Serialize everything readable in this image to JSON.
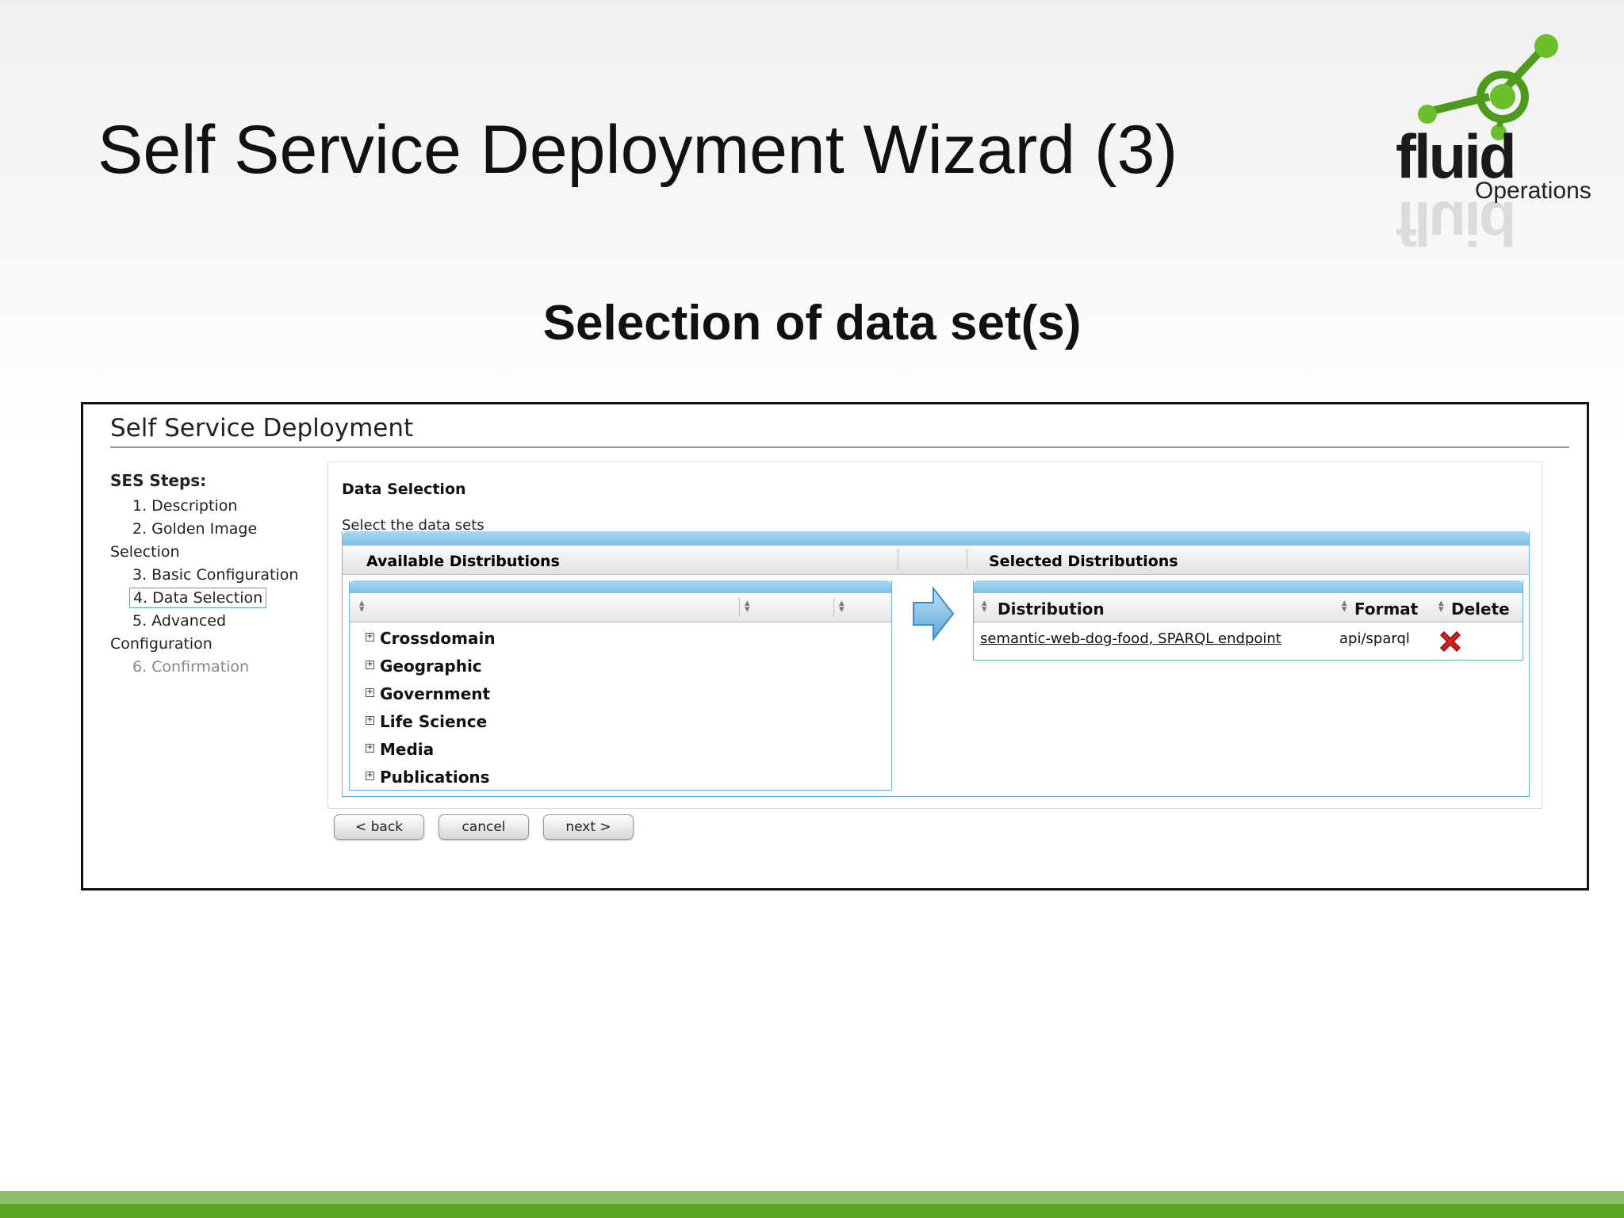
{
  "slide": {
    "title": "Self Service Deployment Wizard (3)",
    "subtitle": "Selection of data set(s)",
    "logo": {
      "word": "fluid",
      "sub": "Operations",
      "accent_color": "#5aa526"
    }
  },
  "app": {
    "title": "Self Service Deployment",
    "steps_heading": "SES Steps:",
    "steps": [
      {
        "label": "1. Description"
      },
      {
        "label": "2. Golden Image",
        "label2": "Selection"
      },
      {
        "label": "3. Basic Configuration"
      },
      {
        "label": "4. Data Selection",
        "state": "active"
      },
      {
        "label": "5. Advanced",
        "label2": "Configuration"
      },
      {
        "label": "6. Confirmation",
        "state": "disabled"
      }
    ]
  },
  "main": {
    "title": "Data Selection",
    "instruction": "Select the data sets",
    "available_header": "Available Distributions",
    "selected_header": "Selected Distributions",
    "tree_items": [
      "Crossdomain",
      "Geographic",
      "Government",
      "Life Science",
      "Media",
      "Publications"
    ],
    "selected_table": {
      "columns": [
        "Distribution",
        "Format",
        "Delete"
      ],
      "rows": [
        {
          "distribution": "semantic-web-dog-food, SPARQL endpoint",
          "format": "api/sparql"
        }
      ]
    }
  },
  "buttons": {
    "back": "< back",
    "cancel": "cancel",
    "next": "next >"
  },
  "colors": {
    "header_blue": "#7fbfe6",
    "delete_red": "#d81e1e",
    "footer_green": "#5aa526"
  }
}
